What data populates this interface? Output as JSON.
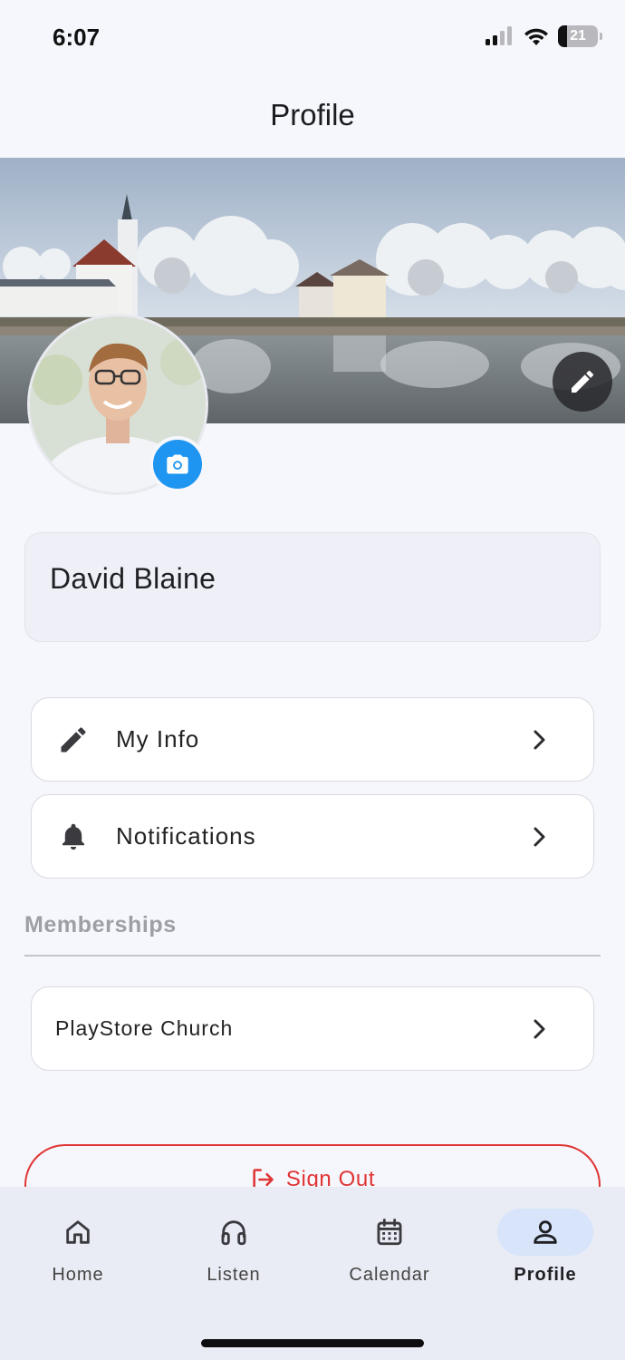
{
  "status_bar": {
    "time": "6:07",
    "battery": "21",
    "battery_level": 0.21
  },
  "header": {
    "title": "Profile"
  },
  "profile": {
    "name": "David Blaine"
  },
  "menu": [
    {
      "label": "My Info",
      "icon": "pencil-icon"
    },
    {
      "label": "Notifications",
      "icon": "bell-icon"
    }
  ],
  "memberships": {
    "title": "Memberships",
    "items": [
      {
        "label": "PlayStore Church"
      }
    ]
  },
  "sign_out": {
    "label": "Sign Out",
    "color": "#e03434"
  },
  "bottom_nav": {
    "items": [
      {
        "label": "Home",
        "icon": "home-icon"
      },
      {
        "label": "Listen",
        "icon": "headphones-icon"
      },
      {
        "label": "Calendar",
        "icon": "calendar-icon"
      },
      {
        "label": "Profile",
        "icon": "person-icon",
        "active": true
      }
    ]
  },
  "colors": {
    "accent": "#1e95f0",
    "nav_active_bg": "#d7e4fa",
    "danger": "#e03434"
  }
}
